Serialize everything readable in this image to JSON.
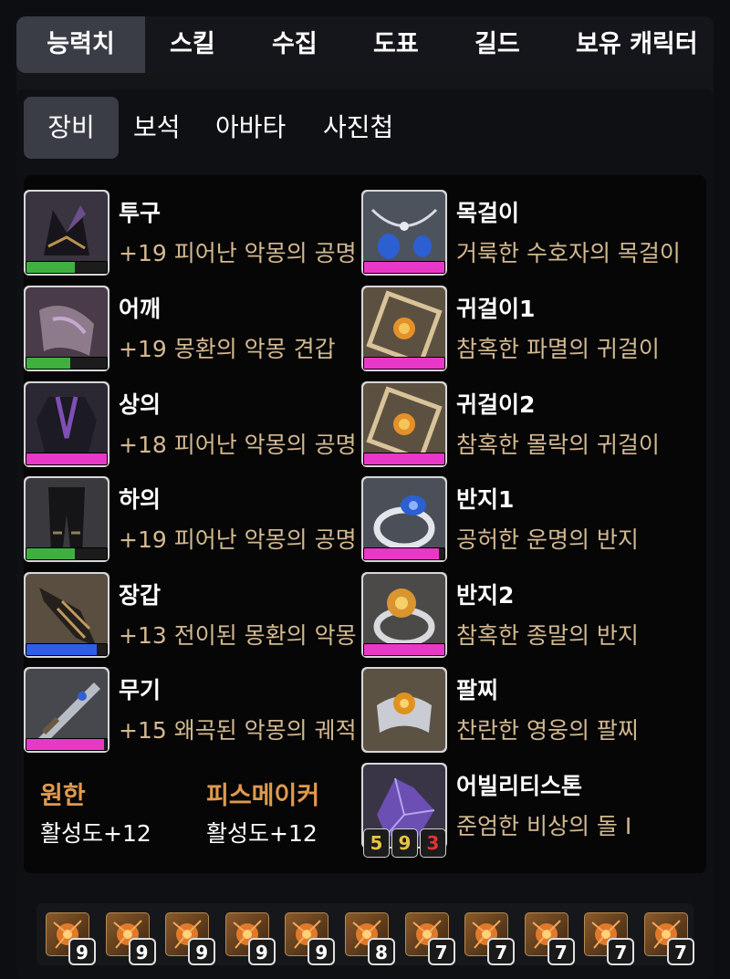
{
  "tabs": [
    "능력치",
    "스킬",
    "수집",
    "도표",
    "길드",
    "보유 캐릭터"
  ],
  "subtabs": [
    "장비",
    "보석",
    "아바타",
    "사진첩"
  ],
  "colors": {
    "green": "#3fb03f",
    "pink": "#e838c8",
    "blue": "#2f5ee6",
    "engrave": "#e09a4d",
    "desc": "#d3b98f"
  },
  "equipment": [
    {
      "name": "투구",
      "desc": "+19 피어난 악몽의 공명",
      "quality_fraction": 0.6,
      "bar_color": "#3fb03f",
      "icon": "helmet-icon"
    },
    {
      "name": "어깨",
      "desc": "+19 몽환의 악몽 견갑",
      "quality_fraction": 0.55,
      "bar_color": "#3fb03f",
      "icon": "shoulder-icon"
    },
    {
      "name": "상의",
      "desc": "+18 피어난 악몽의 공명",
      "quality_fraction": 1.0,
      "bar_color": "#e838c8",
      "icon": "chest-icon"
    },
    {
      "name": "하의",
      "desc": "+19 피어난 악몽의 공명",
      "quality_fraction": 0.6,
      "bar_color": "#3fb03f",
      "icon": "pants-icon"
    },
    {
      "name": "장갑",
      "desc": "+13 전이된 몽환의 악몽",
      "quality_fraction": 0.88,
      "bar_color": "#2f5ee6",
      "icon": "gloves-icon"
    },
    {
      "name": "무기",
      "desc": "+15 왜곡된 악몽의 궤적",
      "quality_fraction": 0.97,
      "bar_color": "#e838c8",
      "icon": "weapon-icon"
    }
  ],
  "accessories": [
    {
      "name": "목걸이",
      "desc": "거룩한 수호자의 목걸이",
      "quality_fraction": 1.0,
      "bar_color": "#e838c8",
      "icon": "necklace-icon"
    },
    {
      "name": "귀걸이1",
      "desc": "참혹한 파멸의 귀걸이",
      "quality_fraction": 1.0,
      "bar_color": "#e838c8",
      "icon": "earring-icon"
    },
    {
      "name": "귀걸이2",
      "desc": "참혹한 몰락의 귀걸이",
      "quality_fraction": 1.0,
      "bar_color": "#e838c8",
      "icon": "earring-icon"
    },
    {
      "name": "반지1",
      "desc": "공허한 운명의 반지",
      "quality_fraction": 0.93,
      "bar_color": "#e838c8",
      "icon": "ring-icon"
    },
    {
      "name": "반지2",
      "desc": "참혹한 종말의 반지",
      "quality_fraction": 1.0,
      "bar_color": "#e838c8",
      "icon": "ring-icon"
    },
    {
      "name": "팔찌",
      "desc": "찬란한 영웅의 팔찌",
      "icon": "bracelet-icon"
    },
    {
      "name": "어빌리티스톤",
      "desc": "준엄한 비상의 돌 I",
      "icon": "ability-stone-icon",
      "badges": [
        "5",
        "9",
        "3"
      ]
    }
  ],
  "engravings": [
    {
      "name": "원한",
      "value": "활성도+12"
    },
    {
      "name": "피스메이커",
      "value": "활성도+12"
    }
  ],
  "gems": [
    "9",
    "9",
    "9",
    "9",
    "9",
    "8",
    "7",
    "7",
    "7",
    "7",
    "7"
  ]
}
